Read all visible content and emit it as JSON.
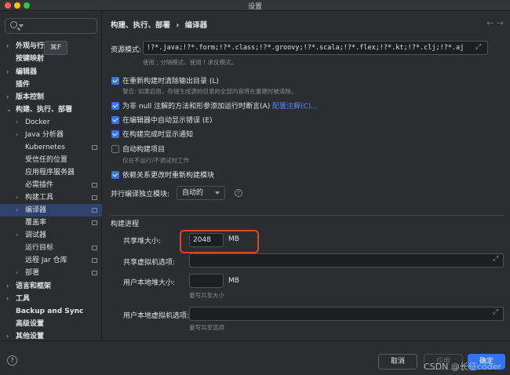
{
  "window": {
    "title": "设置"
  },
  "search": {
    "icon": "search-icon",
    "shortcut": "⌘F"
  },
  "sidebar": {
    "items": [
      {
        "label": "外观与行为",
        "arrow": "›",
        "bold": true
      },
      {
        "label": "按键映射",
        "arrow": "",
        "bold": true
      },
      {
        "label": "编辑器",
        "arrow": "›",
        "bold": true
      },
      {
        "label": "插件",
        "arrow": "",
        "bold": true
      },
      {
        "label": "版本控制",
        "arrow": "›",
        "bold": true
      },
      {
        "label": "构建、执行、部署",
        "arrow": "⌄",
        "bold": true
      },
      {
        "label": "Docker",
        "arrow": "›",
        "bold": false
      },
      {
        "label": "Java 分析器",
        "arrow": "›",
        "bold": false
      },
      {
        "label": "Kubernetes",
        "arrow": "",
        "bold": false
      },
      {
        "label": "受信任的位置",
        "arrow": "",
        "bold": false
      },
      {
        "label": "应用程序服务器",
        "arrow": "",
        "bold": false
      },
      {
        "label": "必需插件",
        "arrow": "",
        "bold": false
      },
      {
        "label": "构建工具",
        "arrow": "›",
        "bold": false
      },
      {
        "label": "编译器",
        "arrow": "›",
        "bold": false
      },
      {
        "label": "覆盖率",
        "arrow": "",
        "bold": false
      },
      {
        "label": "调试器",
        "arrow": "›",
        "bold": false
      },
      {
        "label": "运行目标",
        "arrow": "",
        "bold": false
      },
      {
        "label": "远程 Jar 仓库",
        "arrow": "",
        "bold": false
      },
      {
        "label": "部署",
        "arrow": "›",
        "bold": false
      },
      {
        "label": "语言和框架",
        "arrow": "›",
        "bold": true
      },
      {
        "label": "工具",
        "arrow": "›",
        "bold": true
      },
      {
        "label": "Backup and Sync",
        "arrow": "",
        "bold": true
      },
      {
        "label": "高级设置",
        "arrow": "",
        "bold": true
      },
      {
        "label": "其他设置",
        "arrow": "›",
        "bold": true
      }
    ],
    "selected_label": "编译器"
  },
  "breadcrumb": {
    "part1": "构建、执行、部署",
    "separator": "›",
    "part2": "编译器",
    "back": "←",
    "forward": "→"
  },
  "resource": {
    "label": "资源模式:",
    "value": "!?*.java;!?*.form;!?*.class;!?*.groovy;!?*.scala;!?*.flex;!?*.kt;!?*.clj;!?*.aj",
    "hint": "使用 ; 分隔模式、使用 ! 求反模式。"
  },
  "options": {
    "clear_output": {
      "label": "在重新构建时清除输出目录 (L)",
      "checked": true,
      "hint": "警告: 如果启用，存储生成源的目录的全部内容将在重建时被清除。"
    },
    "not_null": {
      "label": "为非 null 注解的方法和形参添加运行时断言(A)",
      "checked": true,
      "link": "配置注解(C)..."
    },
    "auto_errors": {
      "label": "在编辑器中自动显示错误 (E)",
      "checked": true
    },
    "notify": {
      "label": "在构建完成时显示通知",
      "checked": true
    },
    "auto_build": {
      "label": "自动构建项目",
      "checked": false,
      "hint": "仅在不运行/不调试时工作"
    },
    "rebuild_deps": {
      "label": "依赖关系更改时重新构建模块",
      "checked": true
    }
  },
  "parallel": {
    "label": "并行编译独立模块:",
    "value": "自动的"
  },
  "build_process": {
    "title": "构建进程",
    "shared_heap_label": "共享堆大小:",
    "shared_heap_value": "2048",
    "shared_heap_unit": "MB",
    "shared_vm_label": "共享虚拟机选项:",
    "shared_vm_value": "",
    "user_heap_label": "用户本地堆大小:",
    "user_heap_value": "",
    "user_heap_unit": "MB",
    "user_heap_hint": "重写共享大小",
    "user_vm_label": "用户本地虚拟机选项:",
    "user_vm_value": "",
    "user_vm_hint": "重写共享选项"
  },
  "footer": {
    "help": "?",
    "cancel": "取消",
    "apply": "应用",
    "ok": "确定",
    "watermark": "CSDN @长征coder"
  },
  "colors": {
    "accent": "#3574f0",
    "selection": "#2e436e",
    "highlight_border": "#d9482b",
    "link": "#548af7"
  }
}
